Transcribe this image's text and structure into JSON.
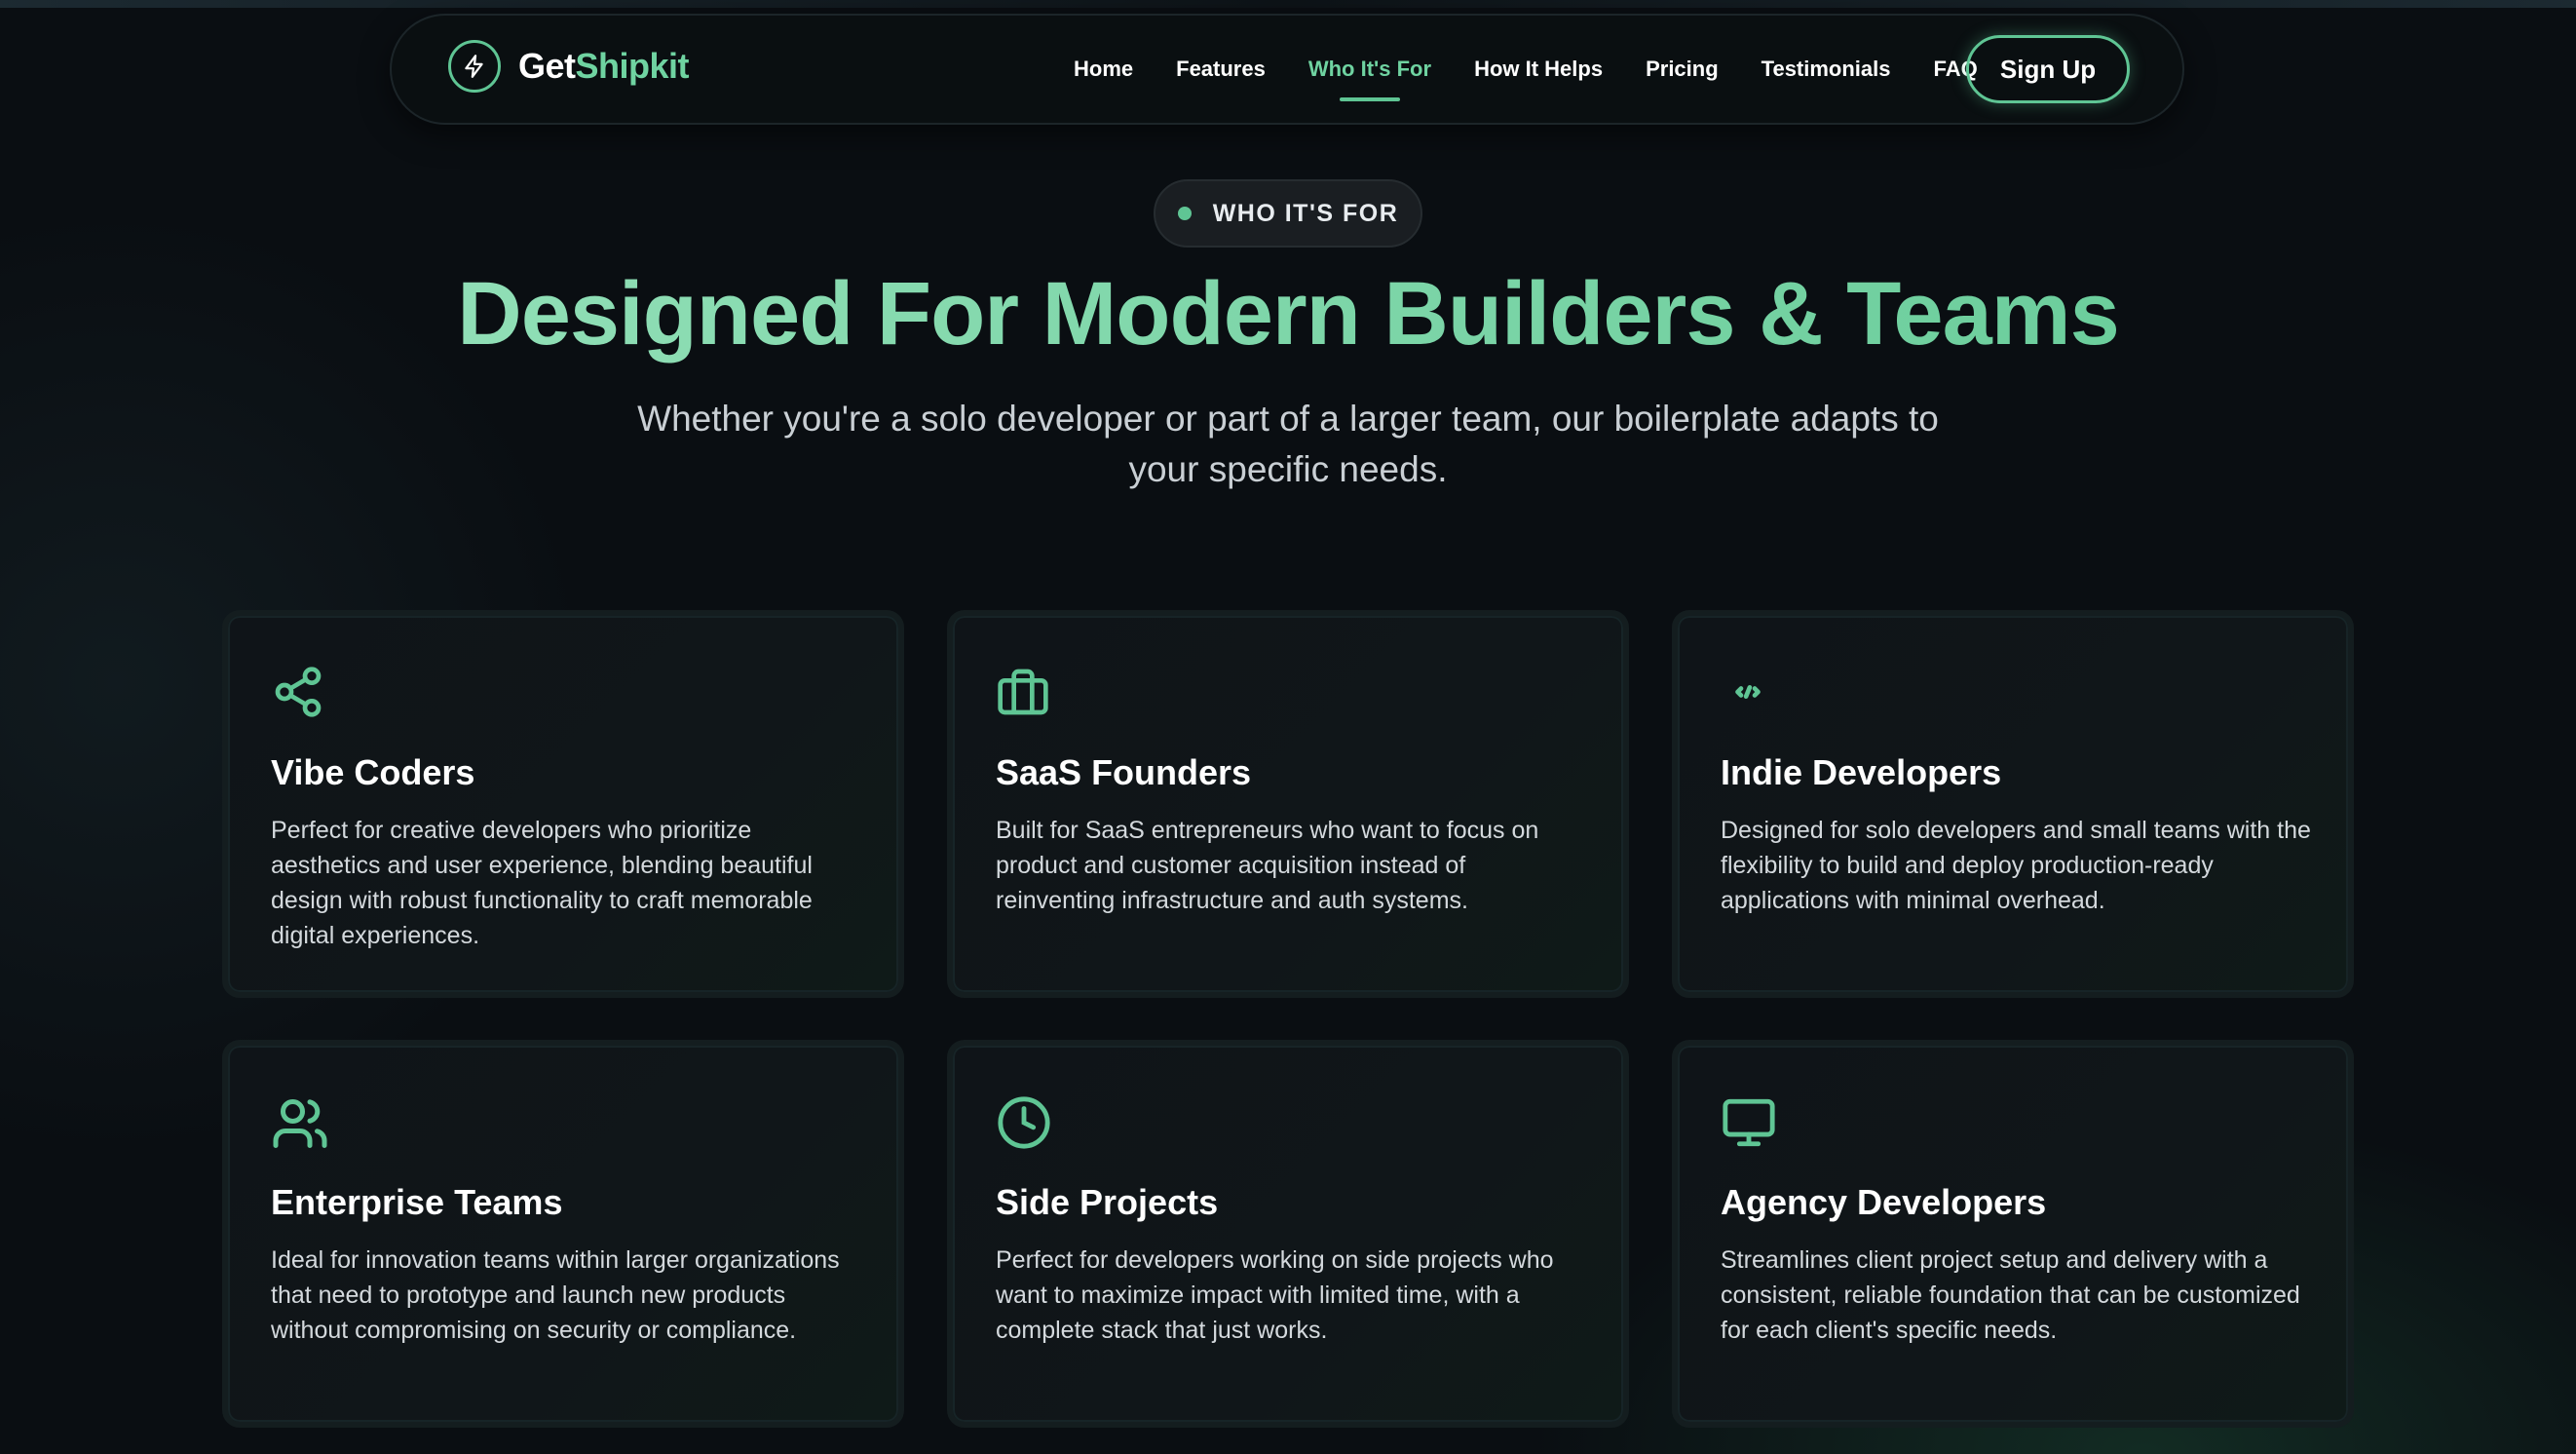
{
  "brand": {
    "name_part1": "Get",
    "name_part2": "Shipkit"
  },
  "nav": {
    "links": [
      "Home",
      "Features",
      "Who It's For",
      "How It Helps",
      "Pricing",
      "Testimonials",
      "FAQ"
    ],
    "active_index": 2,
    "signup_label": "Sign Up"
  },
  "hero": {
    "eyebrow": "WHO IT'S FOR",
    "headline": "Designed For Modern Builders & Teams",
    "subhead": "Whether you're a solo developer or part of a larger team, our boilerplate adapts to your specific needs."
  },
  "cards": [
    {
      "icon": "share-icon",
      "title": "Vibe Coders",
      "description": "Perfect for creative developers who prioritize aesthetics and user experience, blending beautiful design with robust functionality to craft memorable digital experiences."
    },
    {
      "icon": "briefcase-icon",
      "title": "SaaS Founders",
      "description": "Built for SaaS entrepreneurs who want to focus on product and customer acquisition instead of reinventing infrastructure and auth systems."
    },
    {
      "icon": "code-icon",
      "title": "Indie Developers",
      "description": "Designed for solo developers and small teams with the flexibility to build and deploy production-ready applications with minimal overhead."
    },
    {
      "icon": "users-icon",
      "title": "Enterprise Teams",
      "description": "Ideal for innovation teams within larger organizations that need to prototype and launch new products without compromising on security or compliance."
    },
    {
      "icon": "clock-icon",
      "title": "Side Projects",
      "description": "Perfect for developers working on side projects who want to maximize impact with limited time, with a complete stack that just works."
    },
    {
      "icon": "monitor-icon",
      "title": "Agency Developers",
      "description": "Streamlines client project setup and delivery with a consistent, reliable foundation that can be customized for each client's specific needs."
    }
  ],
  "colors": {
    "accent": "#5fc594",
    "accent_light": "#7fd9a8",
    "background": "#0a0e12",
    "card_border": "#141d1f"
  }
}
